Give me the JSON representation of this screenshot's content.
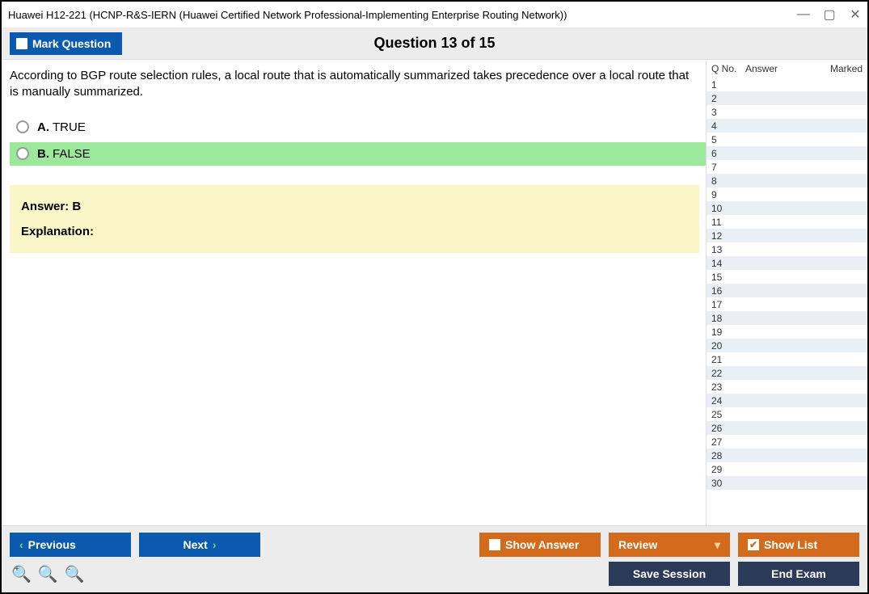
{
  "window": {
    "title": "Huawei H12-221 (HCNP-R&S-IERN (Huawei Certified Network Professional-Implementing Enterprise Routing Network))"
  },
  "header": {
    "mark_label": "Mark Question",
    "question_title": "Question 13 of 15"
  },
  "question": {
    "text": "According to BGP route selection rules, a local route that is automatically summarized takes precedence over a local route that is manually summarized."
  },
  "options": {
    "a": {
      "letter": "A.",
      "text": "TRUE"
    },
    "b": {
      "letter": "B.",
      "text": "FALSE"
    }
  },
  "answer": {
    "line": "Answer: B",
    "explanation_label": "Explanation:"
  },
  "sidebar": {
    "head": {
      "qno": "Q No.",
      "answer": "Answer",
      "marked": "Marked"
    },
    "rows": [
      "1",
      "2",
      "3",
      "4",
      "5",
      "6",
      "7",
      "8",
      "9",
      "10",
      "11",
      "12",
      "13",
      "14",
      "15",
      "16",
      "17",
      "18",
      "19",
      "20",
      "21",
      "22",
      "23",
      "24",
      "25",
      "26",
      "27",
      "28",
      "29",
      "30"
    ]
  },
  "footer": {
    "previous": "Previous",
    "next": "Next",
    "show_answer": "Show Answer",
    "review": "Review",
    "show_list": "Show List",
    "save_session": "Save Session",
    "end_exam": "End Exam"
  }
}
